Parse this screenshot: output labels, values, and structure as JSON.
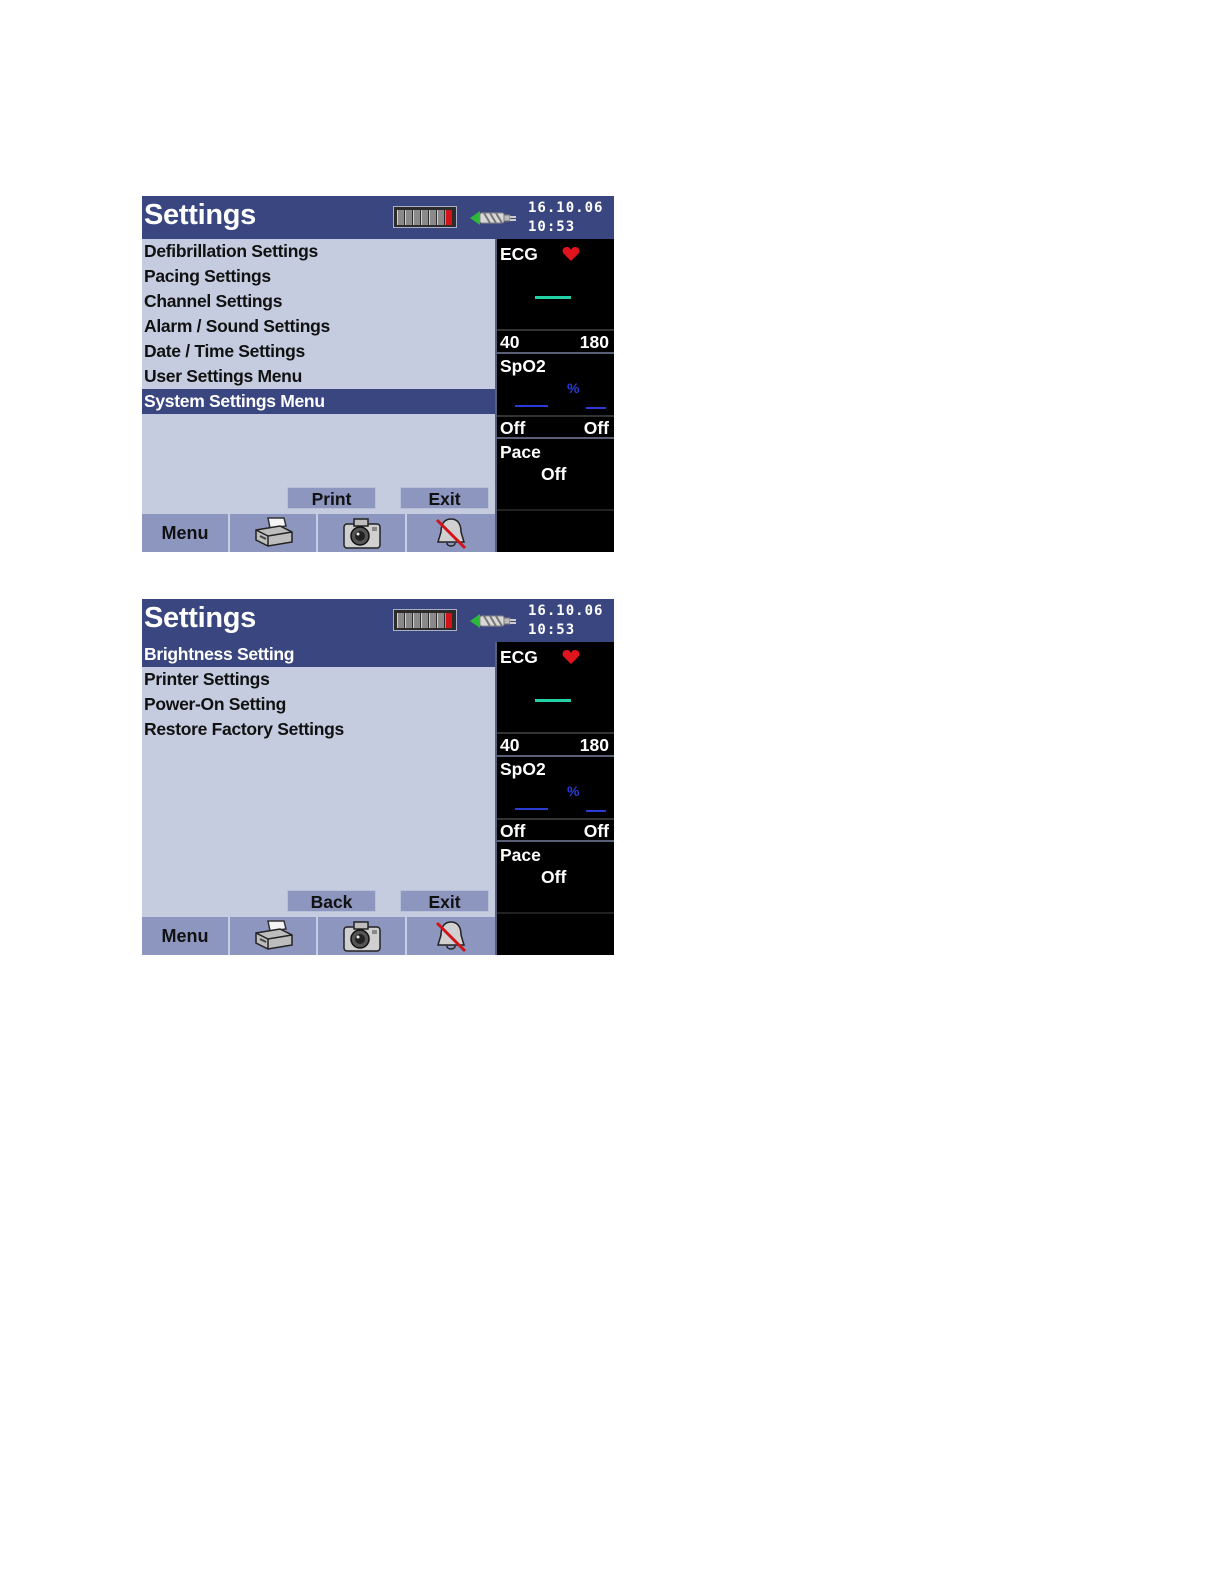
{
  "screens": [
    {
      "title": "Settings",
      "date": "16.10.06",
      "time": "10:53",
      "menu_items": [
        {
          "label": "Defibrillation Settings",
          "selected": false
        },
        {
          "label": "Pacing Settings",
          "selected": false
        },
        {
          "label": "Channel Settings",
          "selected": false
        },
        {
          "label": "Alarm / Sound Settings",
          "selected": false
        },
        {
          "label": "Date / Time Settings",
          "selected": false
        },
        {
          "label": "User Settings Menu",
          "selected": false
        },
        {
          "label": "System Settings Menu",
          "selected": true
        }
      ],
      "softkey_left": "Print",
      "softkey_right": "Exit",
      "bottom_menu_label": "Menu",
      "bottom_icons": [
        "printer-icon",
        "camera-icon",
        "alarm-off-icon"
      ],
      "ecg": {
        "label": "ECG",
        "low": "40",
        "high": "180"
      },
      "spo2": {
        "label": "SpO2",
        "unit": "%",
        "low": "Off",
        "high": "Off"
      },
      "pace": {
        "label": "Pace",
        "value": "Off"
      }
    },
    {
      "title": "Settings",
      "date": "16.10.06",
      "time": "10:53",
      "menu_items": [
        {
          "label": "Brightness Setting",
          "selected": true
        },
        {
          "label": "Printer Settings",
          "selected": false
        },
        {
          "label": "Power-On Setting",
          "selected": false
        },
        {
          "label": "Restore Factory Settings",
          "selected": false
        }
      ],
      "softkey_left": "Back",
      "softkey_right": "Exit",
      "bottom_menu_label": "Menu",
      "bottom_icons": [
        "printer-icon",
        "camera-icon",
        "alarm-off-icon"
      ],
      "ecg": {
        "label": "ECG",
        "low": "40",
        "high": "180"
      },
      "spo2": {
        "label": "SpO2",
        "unit": "%",
        "low": "Off",
        "high": "Off"
      },
      "pace": {
        "label": "Pace",
        "value": "Off"
      }
    }
  ],
  "colors": {
    "title_bar": "#3a4680",
    "menu_background": "#c5cce0",
    "selected_item": "#3a4680",
    "button_face": "#8d96be",
    "ecg_trace": "#22d3a8",
    "spo2_trace": "#2a3bd6",
    "heart": "#e0141c",
    "battery_cell_low": "#d2141a"
  }
}
